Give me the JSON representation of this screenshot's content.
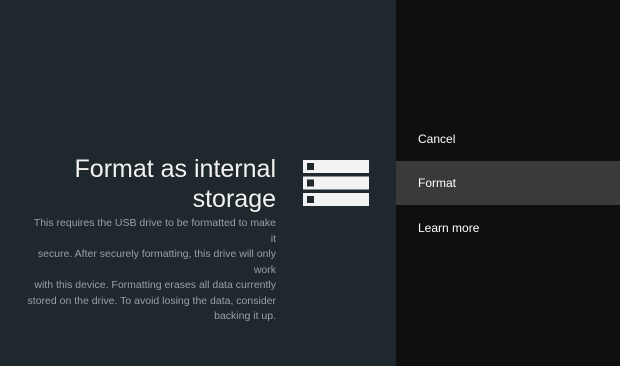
{
  "dialog": {
    "title_line1": "Format as internal",
    "title_line2": "storage",
    "description_lines": [
      "This requires the USB drive to be formatted to make it",
      "secure. After securely formatting, this drive will only work",
      "with this device. Formatting erases all data currently",
      "stored on the drive. To avoid losing the data, consider",
      "backing it up."
    ],
    "icon": "storage-icon"
  },
  "actions": {
    "items": [
      {
        "label": "Cancel"
      },
      {
        "label": "Format",
        "selected": true
      },
      {
        "label": "Learn more"
      }
    ]
  },
  "colors": {
    "left_background": "#1f282d",
    "right_background": "#0f0f0f",
    "selected_item": "#3a3a3a",
    "title_text": "#f2f2f2",
    "description_text": "#98a0a4"
  }
}
